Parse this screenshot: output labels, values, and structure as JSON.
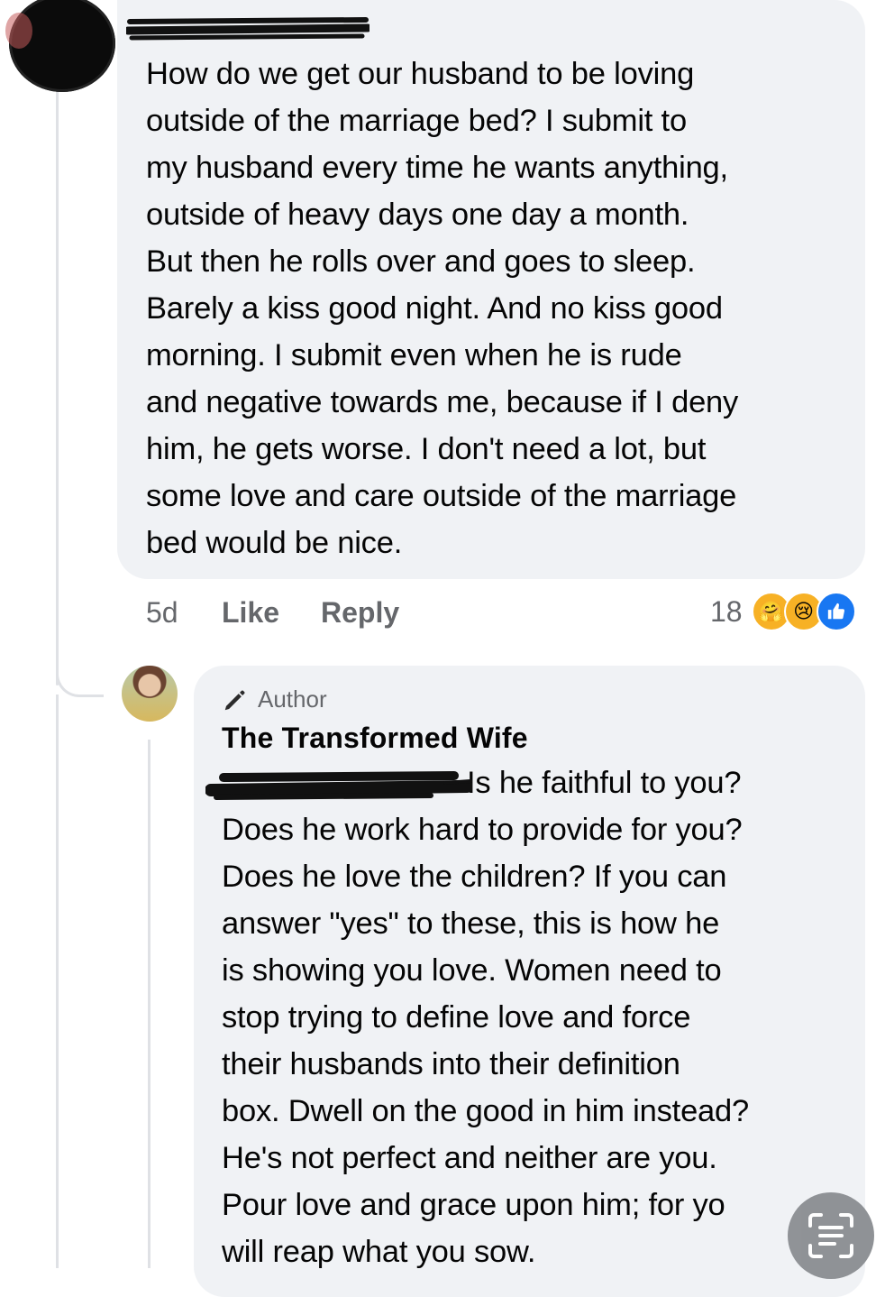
{
  "comment": {
    "author_redacted": true,
    "text": "How do we get our husband to be loving\noutside of the marriage bed? I submit to\nmy husband every time he wants anything,\noutside of heavy days one day a month.\nBut then he rolls over and goes to sleep.\nBarely a kiss good night. And no kiss good\nmorning. I submit even when he is rude\nand negative towards me, because if I deny\nhim, he gets worse. I don't need a lot, but\nsome love and care outside of the marriage\nbed would be nice.",
    "time": "5d",
    "like_label": "Like",
    "reply_label": "Reply",
    "reaction_count": "18",
    "reactions": [
      "care",
      "sad",
      "like"
    ]
  },
  "reply": {
    "badge": "Author",
    "author": "The Transformed Wife",
    "text": "Is he faithful to you?\nDoes he work hard to provide for you?\nDoes he love the children? If you can\nanswer \"yes\" to these, this is how he\nis showing you love. Women need to\nstop trying to define love and force\ntheir husbands into their definition\nbox. Dwell on the good in him instead?\nHe's not perfect and neither are you.\nPour love and grace upon him; for yo\nwill reap what you sow."
  },
  "colors": {
    "bubble": "#f0f2f5",
    "meta": "#65676b",
    "like_blue": "#1877f2"
  }
}
